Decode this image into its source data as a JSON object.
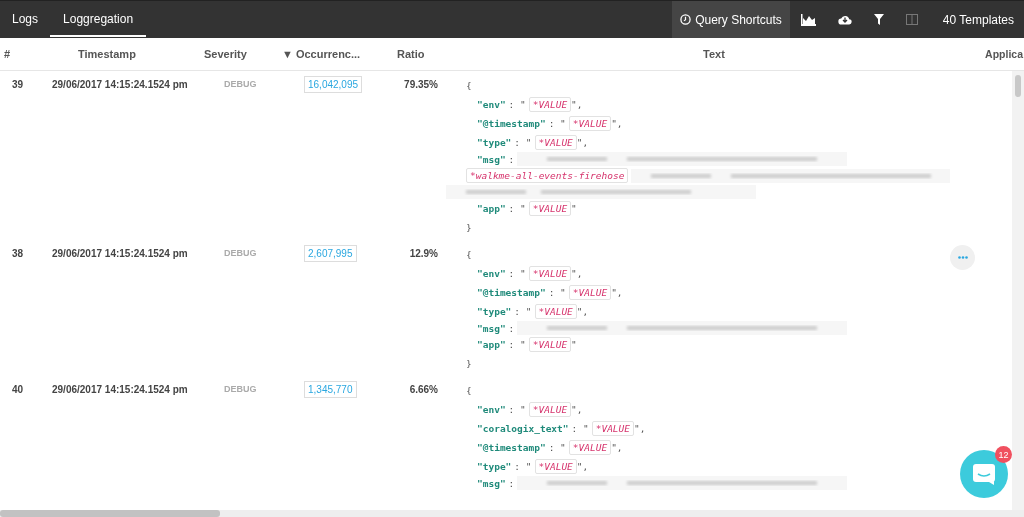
{
  "tabs": [
    {
      "label": "Logs",
      "selected": false
    },
    {
      "label": "Loggregation",
      "selected": true
    }
  ],
  "toolbar": {
    "query_shortcuts": "Query Shortcuts",
    "templates": "40 Templates"
  },
  "columns": [
    "#",
    "Timestamp",
    "Severity",
    "Occurrenc...",
    "Ratio",
    "Text",
    "Applica"
  ],
  "sort_indicator": "▼",
  "rows": [
    {
      "number": "39",
      "timestamp": "29/06/2017 14:15:24.1524 pm",
      "severity": "DEBUG",
      "occurrences": "16,042,095",
      "ratio": "79.35%",
      "menu_visible": false,
      "lines": [
        {
          "kind": "brace",
          "text": "{"
        },
        {
          "kind": "pair",
          "key": "\"env\"",
          "before": ": \"",
          "value": "*VALUE",
          "after": "\","
        },
        {
          "kind": "pair",
          "key": "\"@timestamp\"",
          "before": ": \"",
          "value": "*VALUE",
          "after": "\","
        },
        {
          "kind": "pair",
          "key": "\"type\"",
          "before": ": \"",
          "value": "*VALUE",
          "after": "\","
        },
        {
          "kind": "key_blurred",
          "key": "\"msg\"",
          "before": ":"
        },
        {
          "kind": "tag_blurred",
          "value": "*walkme-all-events-firehose"
        },
        {
          "kind": "blurred"
        },
        {
          "kind": "pair",
          "key": "\"app\"",
          "before": ": \"",
          "value": "*VALUE",
          "after": "\""
        },
        {
          "kind": "brace",
          "text": "}"
        }
      ]
    },
    {
      "number": "38",
      "timestamp": "29/06/2017 14:15:24.1524 pm",
      "severity": "DEBUG",
      "occurrences": "2,607,995",
      "ratio": "12.9%",
      "menu_visible": true,
      "lines": [
        {
          "kind": "brace",
          "text": "{"
        },
        {
          "kind": "pair",
          "key": "\"env\"",
          "before": ": \"",
          "value": "*VALUE",
          "after": "\","
        },
        {
          "kind": "pair",
          "key": "\"@timestamp\"",
          "before": ": \"",
          "value": "*VALUE",
          "after": "\","
        },
        {
          "kind": "pair",
          "key": "\"type\"",
          "before": ": \"",
          "value": "*VALUE",
          "after": "\","
        },
        {
          "kind": "key_blurred",
          "key": "\"msg\"",
          "before": ":"
        },
        {
          "kind": "pair",
          "key": "\"app\"",
          "before": ": \"",
          "value": "*VALUE",
          "after": "\""
        },
        {
          "kind": "brace",
          "text": "}"
        }
      ]
    },
    {
      "number": "40",
      "timestamp": "29/06/2017 14:15:24.1524 pm",
      "severity": "DEBUG",
      "occurrences": "1,345,770",
      "ratio": "6.66%",
      "menu_visible": false,
      "lines": [
        {
          "kind": "brace",
          "text": "{"
        },
        {
          "kind": "pair",
          "key": "\"env\"",
          "before": ": \"",
          "value": "*VALUE",
          "after": "\","
        },
        {
          "kind": "pair",
          "key": "\"coralogix_text\"",
          "before": ": \"",
          "value": "*VALUE",
          "after": "\","
        },
        {
          "kind": "pair",
          "key": "\"@timestamp\"",
          "before": ": \"",
          "value": "*VALUE",
          "after": "\","
        },
        {
          "kind": "pair",
          "key": "\"type\"",
          "before": ": \"",
          "value": "*VALUE",
          "after": "\","
        },
        {
          "kind": "key_blurred",
          "key": "\"msg\"",
          "before": ":"
        }
      ]
    }
  ],
  "chat": {
    "badge": "12"
  }
}
